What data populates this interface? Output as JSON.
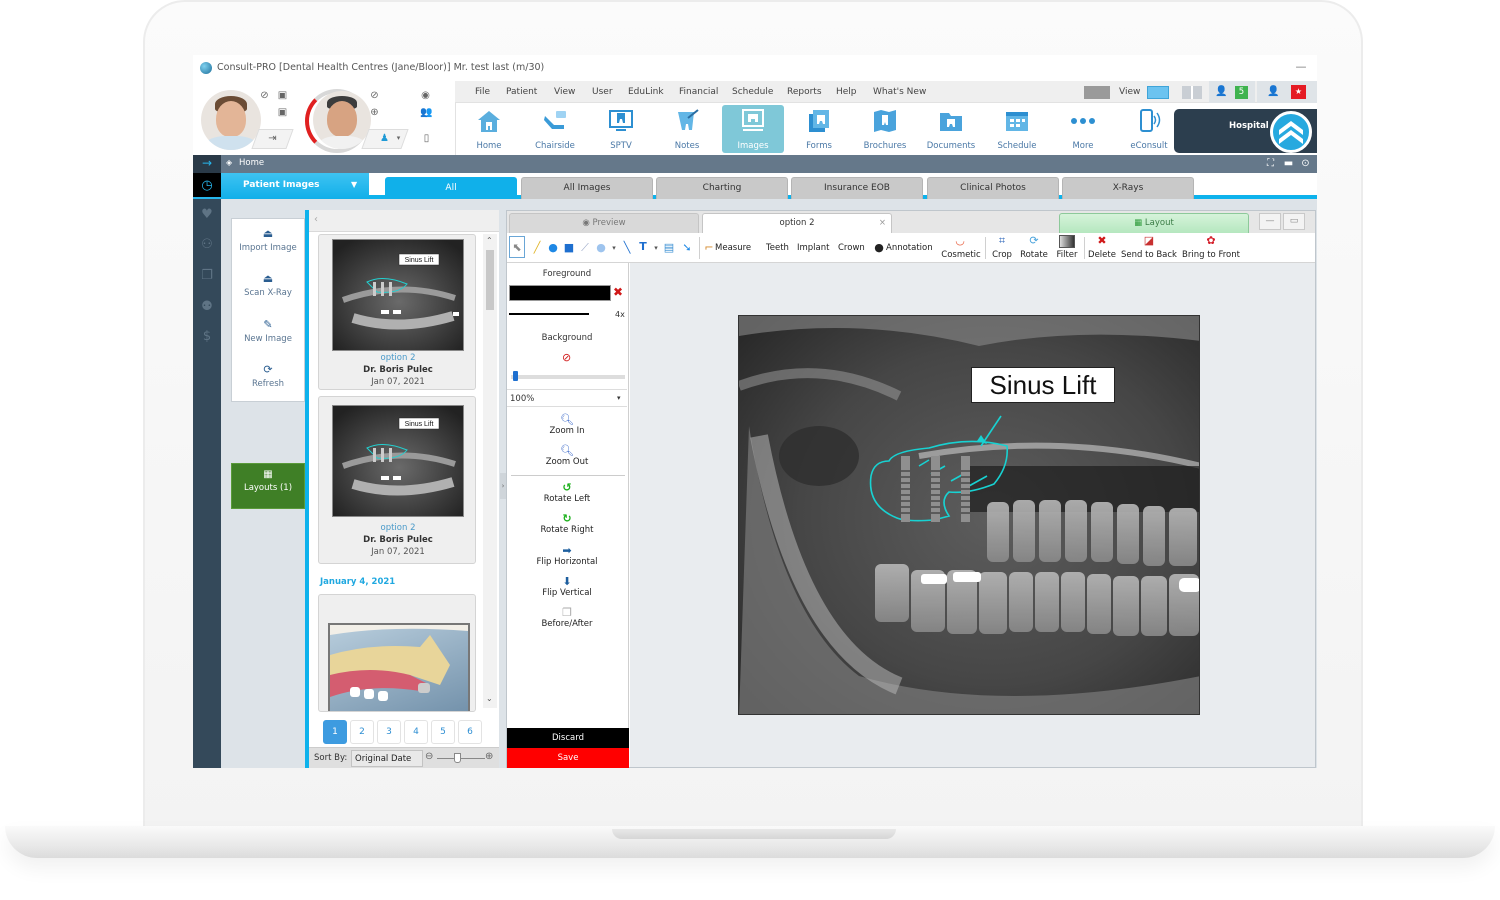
{
  "window": {
    "title": "Consult-PRO [Dental Health Centres (Jane/Bloor)]  Mr. test last (m/30)",
    "minimize_glyph": "—"
  },
  "patient_bar": {
    "doctor_avatar_alt": "Doctor photo",
    "patient_avatar_alt": "Patient photo",
    "icons": [
      "block-icon",
      "camera-icon",
      "camera-icon",
      "logout-icon",
      "block-icon",
      "add-icon",
      "eye-icon",
      "people-icon",
      "user-icon",
      "phone-icon"
    ]
  },
  "menu": {
    "items": [
      "File",
      "Patient",
      "View",
      "User",
      "EduLink",
      "Financial",
      "Schedule",
      "Reports",
      "Help",
      "What's New"
    ],
    "view_label": "View",
    "badge_count": "5"
  },
  "toolbar": {
    "items": [
      {
        "label": "Home",
        "icon": "home-icon"
      },
      {
        "label": "Chairside",
        "icon": "chair-icon"
      },
      {
        "label": "SPTV",
        "icon": "tv-icon"
      },
      {
        "label": "Notes",
        "icon": "notes-icon"
      },
      {
        "label": "Images",
        "icon": "images-icon",
        "active": true
      },
      {
        "label": "Forms",
        "icon": "forms-icon"
      },
      {
        "label": "Brochures",
        "icon": "brochure-icon"
      },
      {
        "label": "Documents",
        "icon": "folder-icon"
      },
      {
        "label": "Schedule",
        "icon": "calendar-icon"
      },
      {
        "label": "More",
        "icon": "more-icon"
      },
      {
        "label": "eConsult",
        "icon": "phone-icon"
      }
    ],
    "hospital_label": "Hospital"
  },
  "nav": {
    "breadcrumb": "Home"
  },
  "category": {
    "dropdown_label": "Patient Images",
    "tabs": [
      "All",
      "All Images",
      "Charting",
      "Insurance EOB",
      "Clinical Photos",
      "X-Rays"
    ],
    "active_tab": "All"
  },
  "actions": {
    "items": [
      {
        "label": "Import Image",
        "icon": "import-icon"
      },
      {
        "label": "Scan X-Ray",
        "icon": "scan-icon"
      },
      {
        "label": "New Image",
        "icon": "new-image-icon"
      },
      {
        "label": "Refresh",
        "icon": "refresh-icon"
      }
    ],
    "layouts_label": "Layouts (1)"
  },
  "thumbnails": {
    "cards": [
      {
        "title": "option 2",
        "author": "Dr. Boris Pulec",
        "date": "Jan 07, 2021",
        "annotation": "Sinus Lift"
      },
      {
        "title": "option 2",
        "author": "Dr. Boris Pulec",
        "date": "Jan 07, 2021",
        "annotation": "Sinus Lift"
      }
    ],
    "group_date": "January 4, 2021",
    "pages": [
      "1",
      "2",
      "3",
      "4",
      "5",
      "6"
    ],
    "active_page": "1",
    "sort_label": "Sort By:",
    "sort_value": "Original Date"
  },
  "editor": {
    "tabs": {
      "preview": "Preview",
      "current": "option 2",
      "close_glyph": "×",
      "layout": "Layout"
    },
    "draw_tools": [
      "Measure",
      "Teeth",
      "Implant",
      "Crown",
      "Annotation"
    ],
    "image_tools": [
      "Cosmetic",
      "Crop",
      "Rotate",
      "Filter",
      "Delete",
      "Send to Back",
      "Bring to Front"
    ],
    "props": {
      "foreground_label": "Foreground",
      "line_width": "4x",
      "background_label": "Background",
      "opacity": "100%",
      "opacity_fraction": 0.02
    },
    "view_tools": [
      "Zoom In",
      "Zoom Out"
    ],
    "transform_tools": [
      "Rotate Left",
      "Rotate Right",
      "Flip Horizontal",
      "Flip Vertical",
      "Before/After"
    ],
    "discard_label": "Discard",
    "save_label": "Save",
    "canvas_annotation": "Sinus Lift"
  },
  "colors": {
    "accent": "#0db2ec",
    "nav_dark": "#34495a",
    "save": "#ff0000",
    "annotation": "#18d2d2",
    "layouts_green": "#3f7f26"
  }
}
